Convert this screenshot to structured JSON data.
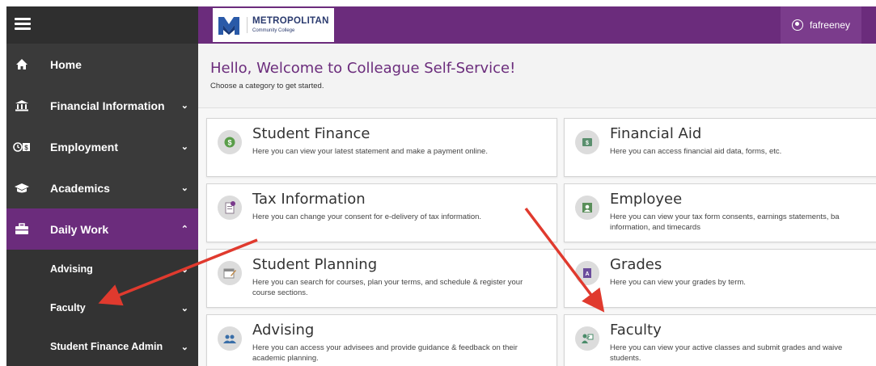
{
  "header": {
    "logo_title": "METROPOLITAN",
    "logo_subtitle": "Community College",
    "username": "fafreeney"
  },
  "sidebar": {
    "items": [
      {
        "label": "Home",
        "icon": "home-icon"
      },
      {
        "label": "Financial Information",
        "icon": "bank-icon"
      },
      {
        "label": "Employment",
        "icon": "clock-money-icon"
      },
      {
        "label": "Academics",
        "icon": "graduation-cap-icon"
      },
      {
        "label": "Daily Work",
        "icon": "briefcase-icon"
      }
    ],
    "subitems": [
      {
        "label": "Advising"
      },
      {
        "label": "Faculty"
      },
      {
        "label": "Student Finance Admin"
      }
    ]
  },
  "welcome": {
    "title": "Hello, Welcome to Colleague Self-Service!",
    "subtitle": "Choose a category to get started."
  },
  "cards": [
    {
      "title": "Student Finance",
      "desc": "Here you can view your latest statement and make a payment online.",
      "icon": "dollar-icon",
      "color": "#5a9e4a"
    },
    {
      "title": "Financial Aid",
      "desc": "Here you can access financial aid data, forms, etc.",
      "icon": "money-icon",
      "color": "#5a8f6e"
    },
    {
      "title": "Tax Information",
      "desc": "Here you can change your consent for e-delivery of tax information.",
      "icon": "document-icon",
      "color": "#7a5a8c"
    },
    {
      "title": "Employee",
      "desc": "Here you can view your tax form consents, earnings statements, ba information, and timecards",
      "icon": "id-card-icon",
      "color": "#5a8f5a"
    },
    {
      "title": "Student Planning",
      "desc": "Here you can search for courses, plan your terms, and schedule & register your course sections.",
      "icon": "calendar-icon",
      "color": "#c08a4a"
    },
    {
      "title": "Grades",
      "desc": "Here you can view your grades by term.",
      "icon": "grade-icon",
      "color": "#6b4c9c"
    },
    {
      "title": "Advising",
      "desc": "Here you can access your advisees and provide guidance & feedback on their academic planning.",
      "icon": "people-icon",
      "color": "#3a6ea8"
    },
    {
      "title": "Faculty",
      "desc": "Here you can view your active classes and submit grades and waive students.",
      "icon": "teacher-icon",
      "color": "#4a8c6a"
    }
  ],
  "colors": {
    "brand_purple": "#6b2c7c",
    "sidebar_dark": "#3a3a3a",
    "arrow_red": "#e03a2e"
  }
}
